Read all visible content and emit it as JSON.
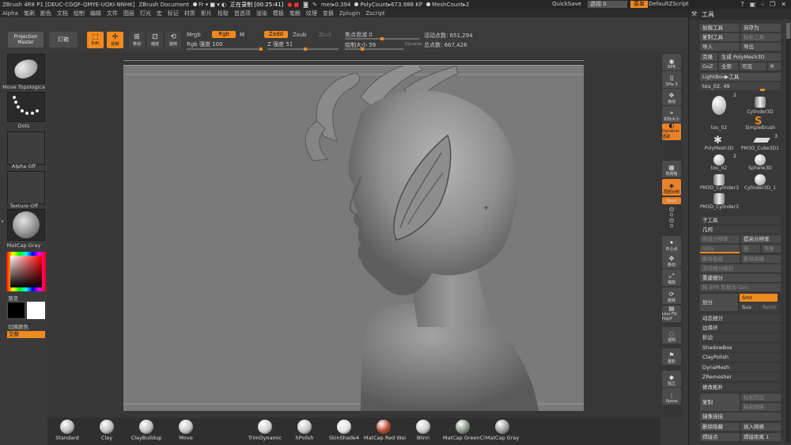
{
  "titlebar": {
    "app": "ZBrush 4R8 P1 [DEUC-CGQF-QMYE-UQKI-NNHK]",
    "document": "ZBrush Document",
    "fr": "Fr",
    "recording": "正在录制 [00:25:41]",
    "mem": "mer",
    "mem_value": "0.394",
    "polycount": "PolyCount",
    "polycount_value": "673.988 KP",
    "meshcount": "MeshCount",
    "meshcount_value": "2",
    "quicksave": "QuickSave",
    "transparency": "透视 0",
    "menu": "菜单",
    "default_zscript": "DefaultZScript"
  },
  "menubar": [
    "Alpha",
    "笔刷",
    "颜色",
    "文档",
    "绘制",
    "编辑",
    "文件",
    "图层",
    "灯光",
    "宏",
    "标记",
    "材质",
    "影片",
    "拾取",
    "首选项",
    "渲染",
    "模板",
    "笔触",
    "纹理",
    "变换",
    "Zplugin",
    "Zscript"
  ],
  "toolbar": {
    "projection_master": "Projection Master",
    "lightbox": "灯箱",
    "edit": "Edit",
    "draw": "绘制",
    "move": "移动",
    "scale": "缩放",
    "rotate": "旋转",
    "mrgb": "Mrgb",
    "rgb": "Rgb",
    "m": "M",
    "zadd": "Zadd",
    "zsub": "Zsub",
    "zcut": "Zcut",
    "rgb_intensity": "Rgb 强度 100",
    "z_intensity": "Z 强度 51",
    "focal_shift": "焦点衰减 0",
    "draw_size": "绘制大小 59",
    "dynamic": "Dynamic",
    "active_points": "活动点数: 651,294",
    "total_points": "总点数: 667,426"
  },
  "lefttray": {
    "move_topological": "Move Topologica",
    "dots": "Dots",
    "alpha_off": "Alpha Off",
    "texture_off": "Texture Off",
    "matcap_gray": "MatCap Gray",
    "gradient": "渐变",
    "switch_color": "切换颜色",
    "alternate": "交替"
  },
  "rightshelf": [
    {
      "name": "sbtn-bpr",
      "label": "BPR"
    },
    {
      "name": "sbtn-spix",
      "label": "SPix 3"
    },
    {
      "name": "sbtn-scroll",
      "label": "滚动"
    },
    {
      "name": "sbtn-zoom",
      "label": "实际大小"
    },
    {
      "name": "sbtn-dynamic",
      "label": "Dynamic 透视"
    },
    {
      "name": "sbtn-floor",
      "label": "地网格"
    },
    {
      "name": "sbtn-local",
      "label": "局部对称"
    },
    {
      "name": "sbtn-xyz",
      "label": "Qxyz"
    },
    {
      "name": "sbtn-rot1",
      "label": "Q"
    },
    {
      "name": "sbtn-rot2",
      "label": "Q"
    },
    {
      "name": "sbtn-frame",
      "label": "中心点"
    },
    {
      "name": "sbtn-move",
      "label": "移动"
    },
    {
      "name": "sbtn-scale",
      "label": "缩放"
    },
    {
      "name": "sbtn-rotate",
      "label": "旋转"
    },
    {
      "name": "sbtn-linefill",
      "label": "Line Fill PolyF"
    },
    {
      "name": "sbtn-transp",
      "label": "透明"
    },
    {
      "name": "sbtn-ghost",
      "label": "重影"
    },
    {
      "name": "sbtn-solo",
      "label": "独立"
    },
    {
      "name": "sbtn-xpose",
      "label": "Xpose"
    }
  ],
  "bottomtray": [
    {
      "label": "Standard",
      "color": "#b9b9b9"
    },
    {
      "label": "Clay",
      "color": "#bdbdbd"
    },
    {
      "label": "ClayBuildup",
      "color": "#c0c0c0"
    },
    {
      "label": "Move",
      "color": "#c5c5c5"
    },
    {
      "label": "TrimDynamic",
      "color": "#cfcfcf"
    },
    {
      "label": "hPolish",
      "color": "#c8c8c8"
    },
    {
      "label": "SkinShade4",
      "color": "#e2e2e2"
    },
    {
      "label": "MatCap Red Wai",
      "color": "#b5442c"
    },
    {
      "label": "Blinn",
      "color": "#c9c9c9"
    },
    {
      "label": "MatCap GreenCl",
      "color": "#8a8f86"
    },
    {
      "label": "MatCap Gray",
      "color": "#9a9a9a"
    }
  ],
  "rightpanel": {
    "title": "工具",
    "load_tool": "加载工具",
    "save_as": "另存为",
    "copy_tool": "复制工具",
    "paste_tool": "粘贴工具",
    "import": "导入",
    "export": "导出",
    "clone": "克隆",
    "make_polymesh": "生成 PolyMesh3D",
    "goz": "GoZ",
    "all": "全部",
    "visible": "可见",
    "r": "R",
    "lightbox_tools": "LightBox▶工具",
    "current_tool": "tou_02. 49",
    "tiles": [
      {
        "label": "tou_02",
        "badge": "2"
      },
      {
        "label": "Cylinder3D",
        "badge": ""
      },
      {
        "label": "SimpleBrush",
        "badge": ""
      },
      {
        "label": "PolyMesh3D",
        "badge": ""
      },
      {
        "label": "PM3D_Cube3D1",
        "badge": "3"
      },
      {
        "label": "tou_02",
        "badge": "2"
      },
      {
        "label": "Sphere3D",
        "badge": ""
      },
      {
        "label": "PM3D_Cylinder3",
        "badge": ""
      },
      {
        "label": "Cylinder3D_1",
        "badge": ""
      },
      {
        "label": "PM3D_Cylinder3",
        "badge": ""
      }
    ],
    "subtool": "子工具",
    "geometry": "几何",
    "lower_res": "降低分辨率",
    "higher_res": "提高分辨率",
    "sdiv": "SDiv",
    "cage": "笼",
    "rstr": "恢复",
    "del_lower": "删除低级",
    "del_higher": "删除高级",
    "freeze_subdiv": "冻结细分级别",
    "reconstruct_subdiv": "重建细分",
    "bpr_to_geo": "将 BPR 转换为 Geo",
    "divide": "划分",
    "smt": "Smt",
    "suv": "Suv",
    "reuv": "ReUV",
    "dynamic_subdiv": "动态细分",
    "edge_loop": "边缘环",
    "crease": "折边",
    "shadowbox": "ShadowBox",
    "claypolish": "ClayPolish",
    "dynamesh": "DynaMesh",
    "zremesher": "ZRemesher",
    "modify_topology": "修改拓扑",
    "copy": "复制",
    "paste_append": "粘贴追加",
    "paste_replace": "粘贴替换",
    "mirror_weld": "镜像连接",
    "del_hidden": "删除隐藏",
    "insert_mesh": "插入网格",
    "weld_points": "焊接点",
    "weld_dist": "焊接距离 1"
  },
  "colors": {
    "accent": "#f08a1e",
    "canvas": "#7a7a7a"
  }
}
